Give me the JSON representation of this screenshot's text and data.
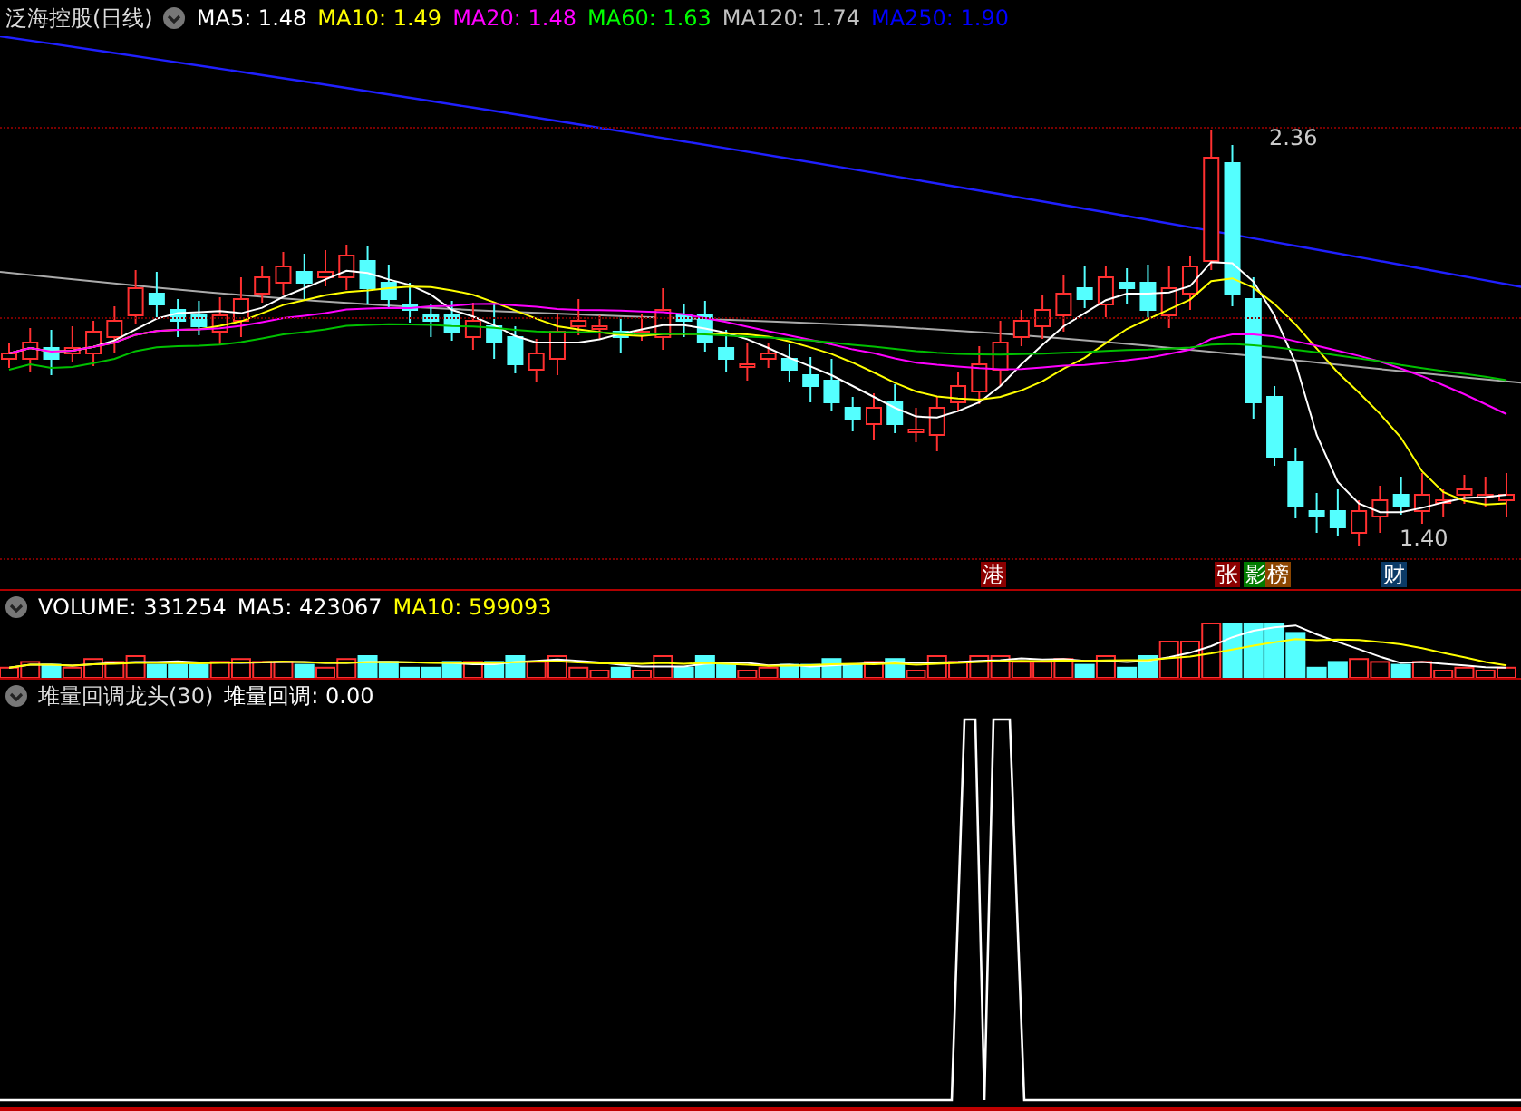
{
  "main_pane": {
    "title": "泛海控股(日线)",
    "indicators": [
      {
        "text": "MA5: 1.48",
        "color": "#ffffff"
      },
      {
        "text": "MA10: 1.49",
        "color": "#ffff00"
      },
      {
        "text": "MA20: 1.48",
        "color": "#ff00ff"
      },
      {
        "text": "MA60: 1.63",
        "color": "#00ff00"
      },
      {
        "text": "MA120: 1.74",
        "color": "#c0c0c0"
      },
      {
        "text": "MA250: 1.90",
        "color": "#0000ff"
      }
    ],
    "high_label": "2.36",
    "low_label": "1.40",
    "event_badges": [
      {
        "text": "港",
        "color": "#8b0000"
      },
      {
        "text": "张",
        "color": "#8b0000"
      },
      {
        "text": "影",
        "color": "#007a00"
      },
      {
        "text": "榜",
        "color": "#8b4500"
      },
      {
        "text": "财",
        "color": "#0b3a66"
      }
    ]
  },
  "volume_pane": {
    "indicators": [
      {
        "text": "VOLUME: 331254",
        "color": "#ffffff"
      },
      {
        "text": "MA5: 423067",
        "color": "#ffffff"
      },
      {
        "text": "MA10: 599093",
        "color": "#ffff00"
      }
    ]
  },
  "signal_pane": {
    "title": "堆量回调龙头(30)",
    "indicators": [
      {
        "text": "堆量回调: 0.00",
        "color": "#ffffff"
      }
    ]
  }
}
